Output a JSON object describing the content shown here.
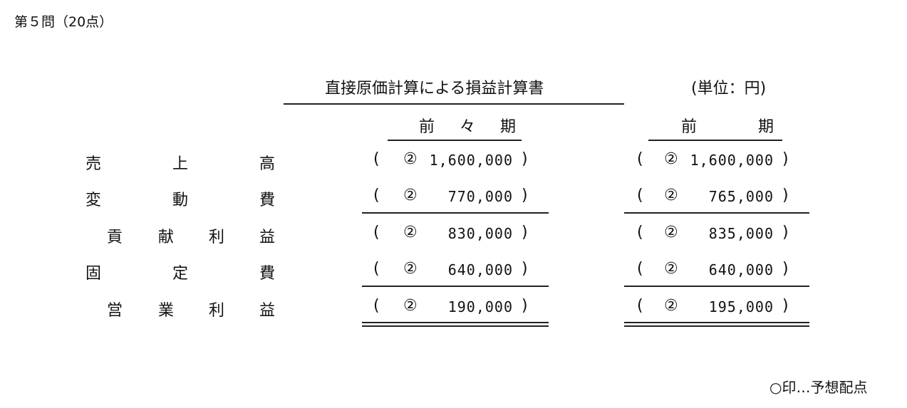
{
  "header": {
    "question": "第５問（20点）"
  },
  "statement": {
    "title": "直接原価計算による損益計算書",
    "unit": "(単位：円)"
  },
  "periods": [
    "前 々 期",
    "前　　期"
  ],
  "rows": [
    {
      "label": [
        "売",
        "上",
        "高"
      ],
      "values": [
        {
          "mark": "②",
          "amount": "1,600,000"
        },
        {
          "mark": "②",
          "amount": "1,600,000"
        }
      ]
    },
    {
      "label": [
        "変",
        "動",
        "費"
      ],
      "values": [
        {
          "mark": "②",
          "amount": "770,000"
        },
        {
          "mark": "②",
          "amount": "765,000"
        }
      ]
    },
    {
      "label": [
        "貢",
        "献",
        "利",
        "益"
      ],
      "values": [
        {
          "mark": "②",
          "amount": "830,000"
        },
        {
          "mark": "②",
          "amount": "835,000"
        }
      ]
    },
    {
      "label": [
        "固",
        "定",
        "費"
      ],
      "values": [
        {
          "mark": "②",
          "amount": "640,000"
        },
        {
          "mark": "②",
          "amount": "640,000"
        }
      ]
    },
    {
      "label": [
        "営",
        "業",
        "利",
        "益"
      ],
      "values": [
        {
          "mark": "②",
          "amount": "190,000"
        },
        {
          "mark": "②",
          "amount": "195,000"
        }
      ]
    }
  ],
  "paren": {
    "open": "(",
    "close": ")"
  },
  "footer": {
    "note": "○印…予想配点"
  }
}
